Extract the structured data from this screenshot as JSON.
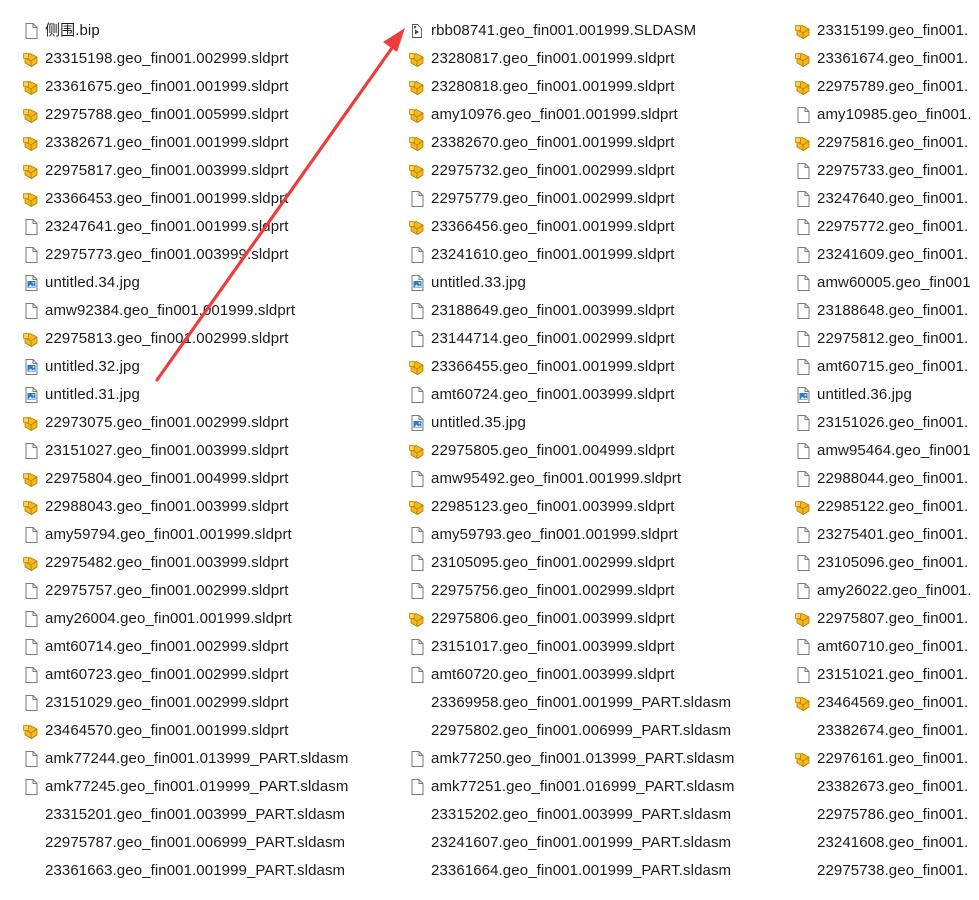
{
  "accent_color": "#ee3b3b",
  "columns": [
    {
      "items": [
        {
          "icon": "generic-file-icon",
          "name": "侧围.bip"
        },
        {
          "icon": "solidworks-part-icon",
          "name": "23315198.geo_fin001.002999.sldprt"
        },
        {
          "icon": "solidworks-part-icon",
          "name": "23361675.geo_fin001.001999.sldprt"
        },
        {
          "icon": "solidworks-part-icon",
          "name": "22975788.geo_fin001.005999.sldprt"
        },
        {
          "icon": "solidworks-part-icon",
          "name": "23382671.geo_fin001.001999.sldprt"
        },
        {
          "icon": "solidworks-part-icon",
          "name": "22975817.geo_fin001.003999.sldprt"
        },
        {
          "icon": "solidworks-part-icon",
          "name": "23366453.geo_fin001.001999.sldprt"
        },
        {
          "icon": "generic-file-icon",
          "name": "23247641.geo_fin001.001999.sldprt"
        },
        {
          "icon": "generic-file-icon",
          "name": "22975773.geo_fin001.003999.sldprt"
        },
        {
          "icon": "image-file-icon",
          "name": "untitled.34.jpg"
        },
        {
          "icon": "generic-file-icon",
          "name": "amw92384.geo_fin001.001999.sldprt"
        },
        {
          "icon": "solidworks-part-icon",
          "name": "22975813.geo_fin001.002999.sldprt"
        },
        {
          "icon": "image-file-icon",
          "name": "untitled.32.jpg"
        },
        {
          "icon": "image-file-icon",
          "name": "untitled.31.jpg"
        },
        {
          "icon": "solidworks-part-icon",
          "name": "22973075.geo_fin001.002999.sldprt"
        },
        {
          "icon": "generic-file-icon",
          "name": "23151027.geo_fin001.003999.sldprt"
        },
        {
          "icon": "solidworks-part-icon",
          "name": "22975804.geo_fin001.004999.sldprt"
        },
        {
          "icon": "solidworks-part-icon",
          "name": "22988043.geo_fin001.003999.sldprt"
        },
        {
          "icon": "generic-file-icon",
          "name": "amy59794.geo_fin001.001999.sldprt"
        },
        {
          "icon": "solidworks-part-icon",
          "name": "22975482.geo_fin001.003999.sldprt"
        },
        {
          "icon": "generic-file-icon",
          "name": "22975757.geo_fin001.002999.sldprt"
        },
        {
          "icon": "generic-file-icon",
          "name": "amy26004.geo_fin001.001999.sldprt"
        },
        {
          "icon": "generic-file-icon",
          "name": "amt60714.geo_fin001.002999.sldprt"
        },
        {
          "icon": "generic-file-icon",
          "name": "amt60723.geo_fin001.002999.sldprt"
        },
        {
          "icon": "generic-file-icon",
          "name": "23151029.geo_fin001.002999.sldprt"
        },
        {
          "icon": "solidworks-part-icon",
          "name": "23464570.geo_fin001.001999.sldprt"
        },
        {
          "icon": "generic-file-icon",
          "name": "amk77244.geo_fin001.013999_PART.sldasm"
        },
        {
          "icon": "generic-file-icon",
          "name": "amk77245.geo_fin001.019999_PART.sldasm"
        },
        {
          "icon": "blank-icon",
          "name": "23315201.geo_fin001.003999_PART.sldasm"
        },
        {
          "icon": "blank-icon",
          "name": "22975787.geo_fin001.006999_PART.sldasm"
        },
        {
          "icon": "blank-icon",
          "name": "23361663.geo_fin001.001999_PART.sldasm"
        }
      ]
    },
    {
      "items": [
        {
          "icon": "solidworks-assembly-icon",
          "name": "rbb08741.geo_fin001.001999.SLDASM"
        },
        {
          "icon": "solidworks-part-icon",
          "name": "23280817.geo_fin001.001999.sldprt"
        },
        {
          "icon": "solidworks-part-icon",
          "name": "23280818.geo_fin001.001999.sldprt"
        },
        {
          "icon": "solidworks-part-icon",
          "name": "amy10976.geo_fin001.001999.sldprt"
        },
        {
          "icon": "solidworks-part-icon",
          "name": "23382670.geo_fin001.001999.sldprt"
        },
        {
          "icon": "solidworks-part-icon",
          "name": "22975732.geo_fin001.002999.sldprt"
        },
        {
          "icon": "generic-file-icon",
          "name": "22975779.geo_fin001.002999.sldprt"
        },
        {
          "icon": "solidworks-part-icon",
          "name": "23366456.geo_fin001.001999.sldprt"
        },
        {
          "icon": "generic-file-icon",
          "name": "23241610.geo_fin001.001999.sldprt"
        },
        {
          "icon": "image-file-icon",
          "name": "untitled.33.jpg"
        },
        {
          "icon": "generic-file-icon",
          "name": "23188649.geo_fin001.003999.sldprt"
        },
        {
          "icon": "generic-file-icon",
          "name": "23144714.geo_fin001.002999.sldprt"
        },
        {
          "icon": "solidworks-part-icon",
          "name": "23366455.geo_fin001.001999.sldprt"
        },
        {
          "icon": "generic-file-icon",
          "name": "amt60724.geo_fin001.003999.sldprt"
        },
        {
          "icon": "image-file-icon",
          "name": "untitled.35.jpg"
        },
        {
          "icon": "solidworks-part-icon",
          "name": "22975805.geo_fin001.004999.sldprt"
        },
        {
          "icon": "generic-file-icon",
          "name": "amw95492.geo_fin001.001999.sldprt"
        },
        {
          "icon": "solidworks-part-icon",
          "name": "22985123.geo_fin001.003999.sldprt"
        },
        {
          "icon": "generic-file-icon",
          "name": "amy59793.geo_fin001.001999.sldprt"
        },
        {
          "icon": "generic-file-icon",
          "name": "23105095.geo_fin001.002999.sldprt"
        },
        {
          "icon": "generic-file-icon",
          "name": "22975756.geo_fin001.002999.sldprt"
        },
        {
          "icon": "solidworks-part-icon",
          "name": "22975806.geo_fin001.003999.sldprt"
        },
        {
          "icon": "generic-file-icon",
          "name": "23151017.geo_fin001.003999.sldprt"
        },
        {
          "icon": "generic-file-icon",
          "name": "amt60720.geo_fin001.003999.sldprt"
        },
        {
          "icon": "blank-icon",
          "name": "23369958.geo_fin001.001999_PART.sldasm"
        },
        {
          "icon": "blank-icon",
          "name": "22975802.geo_fin001.006999_PART.sldasm"
        },
        {
          "icon": "generic-file-icon",
          "name": "amk77250.geo_fin001.013999_PART.sldasm"
        },
        {
          "icon": "generic-file-icon",
          "name": "amk77251.geo_fin001.016999_PART.sldasm"
        },
        {
          "icon": "blank-icon",
          "name": "23315202.geo_fin001.003999_PART.sldasm"
        },
        {
          "icon": "blank-icon",
          "name": "23241607.geo_fin001.001999_PART.sldasm"
        },
        {
          "icon": "blank-icon",
          "name": "23361664.geo_fin001.001999_PART.sldasm"
        }
      ]
    },
    {
      "items": [
        {
          "icon": "solidworks-part-icon",
          "name": "23315199.geo_fin001."
        },
        {
          "icon": "solidworks-part-icon",
          "name": "23361674.geo_fin001."
        },
        {
          "icon": "solidworks-part-icon",
          "name": "22975789.geo_fin001."
        },
        {
          "icon": "generic-file-icon",
          "name": "amy10985.geo_fin001."
        },
        {
          "icon": "solidworks-part-icon",
          "name": "22975816.geo_fin001."
        },
        {
          "icon": "generic-file-icon",
          "name": "22975733.geo_fin001."
        },
        {
          "icon": "generic-file-icon",
          "name": "23247640.geo_fin001."
        },
        {
          "icon": "generic-file-icon",
          "name": "22975772.geo_fin001."
        },
        {
          "icon": "generic-file-icon",
          "name": "23241609.geo_fin001."
        },
        {
          "icon": "generic-file-icon",
          "name": "amw60005.geo_fin001"
        },
        {
          "icon": "generic-file-icon",
          "name": "23188648.geo_fin001."
        },
        {
          "icon": "generic-file-icon",
          "name": "22975812.geo_fin001."
        },
        {
          "icon": "generic-file-icon",
          "name": "amt60715.geo_fin001."
        },
        {
          "icon": "image-file-icon",
          "name": "untitled.36.jpg"
        },
        {
          "icon": "generic-file-icon",
          "name": "23151026.geo_fin001."
        },
        {
          "icon": "generic-file-icon",
          "name": "amw95464.geo_fin001"
        },
        {
          "icon": "generic-file-icon",
          "name": "22988044.geo_fin001."
        },
        {
          "icon": "solidworks-part-icon",
          "name": "22985122.geo_fin001."
        },
        {
          "icon": "generic-file-icon",
          "name": "23275401.geo_fin001."
        },
        {
          "icon": "generic-file-icon",
          "name": "23105096.geo_fin001."
        },
        {
          "icon": "generic-file-icon",
          "name": "amy26022.geo_fin001."
        },
        {
          "icon": "solidworks-part-icon",
          "name": "22975807.geo_fin001."
        },
        {
          "icon": "generic-file-icon",
          "name": "amt60710.geo_fin001."
        },
        {
          "icon": "generic-file-icon",
          "name": "23151021.geo_fin001."
        },
        {
          "icon": "solidworks-part-icon",
          "name": "23464569.geo_fin001."
        },
        {
          "icon": "blank-icon",
          "name": "23382674.geo_fin001."
        },
        {
          "icon": "solidworks-part-icon",
          "name": "22976161.geo_fin001."
        },
        {
          "icon": "blank-icon",
          "name": "23382673.geo_fin001."
        },
        {
          "icon": "blank-icon",
          "name": "22975786.geo_fin001."
        },
        {
          "icon": "blank-icon",
          "name": "23241608.geo_fin001."
        },
        {
          "icon": "blank-icon",
          "name": "22975738.geo_fin001."
        }
      ]
    }
  ]
}
